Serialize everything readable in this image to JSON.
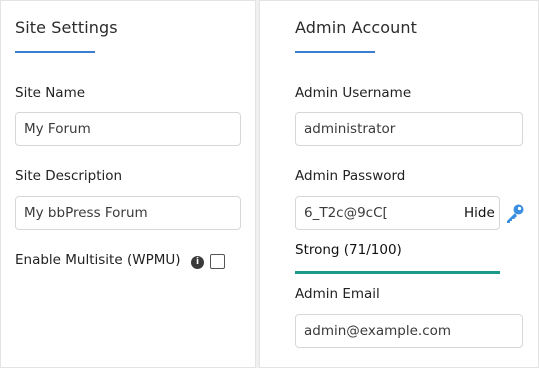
{
  "site_settings": {
    "title": "Site Settings",
    "site_name": {
      "label": "Site Name",
      "value": "My Forum"
    },
    "site_description": {
      "label": "Site Description",
      "value": "My bbPress Forum"
    },
    "multisite": {
      "label": "Enable Multisite (WPMU)",
      "checked": false,
      "info_icon": "info-circle-icon"
    }
  },
  "admin_account": {
    "title": "Admin Account",
    "username": {
      "label": "Admin Username",
      "value": "administrator"
    },
    "password": {
      "label": "Admin Password",
      "value": "6_T2c@9cC[",
      "toggle_label": "Hide",
      "key_icon": "key-icon",
      "strength_text": "Strong (71/100)",
      "strength_score": 71,
      "strength_max": 100,
      "strength_color": "#1b9a8a"
    },
    "email": {
      "label": "Admin Email",
      "value": "admin@example.com"
    }
  },
  "accent_color": "#3b7fd4"
}
